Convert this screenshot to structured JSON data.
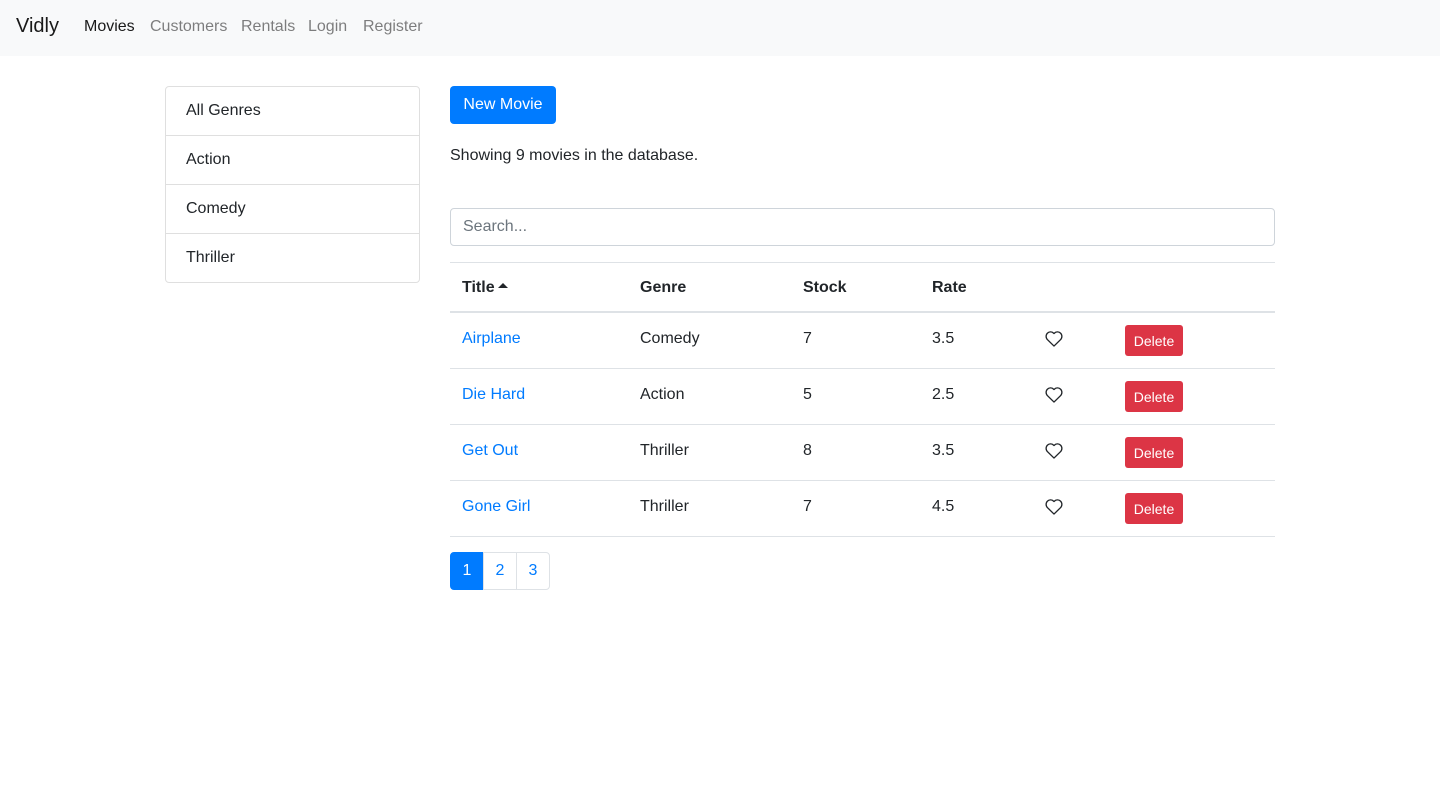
{
  "navbar": {
    "brand": "Vidly",
    "links": [
      "Movies",
      "Customers",
      "Rentals",
      "Login",
      "Register"
    ],
    "active": "Movies"
  },
  "genres": [
    "All Genres",
    "Action",
    "Comedy",
    "Thriller"
  ],
  "toolbar": {
    "new_movie_label": "New Movie"
  },
  "summary": "Showing 9 movies in the database.",
  "search": {
    "placeholder": "Search...",
    "value": ""
  },
  "table": {
    "headers": {
      "title": "Title",
      "genre": "Genre",
      "stock": "Stock",
      "rate": "Rate"
    },
    "sort": {
      "column": "Title",
      "direction": "ascending",
      "icon": "caret-up-icon"
    },
    "rows": [
      {
        "title": "Airplane",
        "genre": "Comedy",
        "stock": "7",
        "rate": "3.5",
        "liked": false,
        "delete_label": "Delete"
      },
      {
        "title": "Die Hard",
        "genre": "Action",
        "stock": "5",
        "rate": "2.5",
        "liked": false,
        "delete_label": "Delete"
      },
      {
        "title": "Get Out",
        "genre": "Thriller",
        "stock": "8",
        "rate": "3.5",
        "liked": false,
        "delete_label": "Delete"
      },
      {
        "title": "Gone Girl",
        "genre": "Thriller",
        "stock": "7",
        "rate": "4.5",
        "liked": false,
        "delete_label": "Delete"
      }
    ]
  },
  "pagination": {
    "pages": [
      "1",
      "2",
      "3"
    ],
    "current": "1"
  },
  "colors": {
    "primary": "#007bff",
    "danger": "#dc3545",
    "navbar_bg": "#f8f9fa"
  }
}
